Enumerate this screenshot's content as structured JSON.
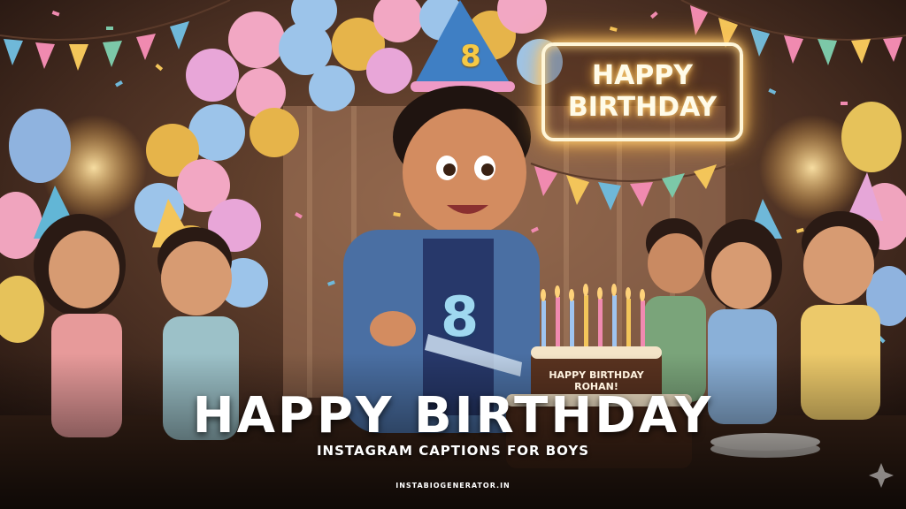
{
  "title": "HAPPY BIRTHDAY",
  "subtitle": "INSTAGRAM CAPTIONS FOR BOYS",
  "website": "INSTABIOGENERATOR.IN",
  "neon_sign": {
    "line1": "HAPPY",
    "line2": "BIRTHDAY"
  },
  "party_hat_number": "8",
  "shirt_number": "8",
  "cake_text": {
    "line1": "HAPPY BIRTHDAY",
    "line2": "ROHAN!"
  },
  "colors": {
    "background": "#3a241b",
    "neon_glow": "#ffd27a",
    "title_text": "#ffffff"
  }
}
